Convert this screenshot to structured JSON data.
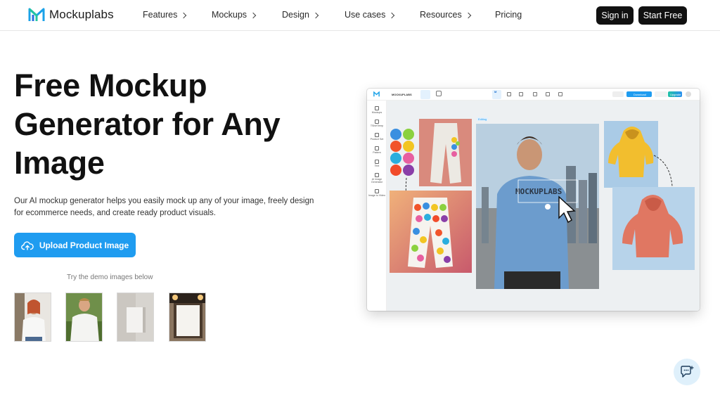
{
  "nav": {
    "logo_text": "Mockuplabs",
    "menu": [
      {
        "label": "Features",
        "has_chevron": true
      },
      {
        "label": "Mockups",
        "has_chevron": true
      },
      {
        "label": "Design",
        "has_chevron": true
      },
      {
        "label": "Use cases",
        "has_chevron": true
      },
      {
        "label": "Resources",
        "has_chevron": true
      },
      {
        "label": "Pricing",
        "has_chevron": false
      }
    ],
    "signin_label": "Sign in",
    "start_label": "Start Free"
  },
  "hero": {
    "title": "Free Mockup Generator for Any Image",
    "subtitle": "Our AI mockup generator helps you easily mock up any of your image, freely design for ecommerce needs, and create ready product visuals.",
    "upload_label": "Upload Product Image",
    "demo_label": "Try the demo images below",
    "demo_images": [
      "woman-white-tshirt",
      "man-white-hoodie",
      "blank-card",
      "framed-poster"
    ]
  },
  "app_preview": {
    "brand": "MOCKUPLABS",
    "toolbar": [
      "Mockup",
      "Edit",
      "Photoshop",
      "Magic",
      "Layers",
      "Canvas"
    ],
    "download_label": "Download",
    "upgrade_label": "Upgrade",
    "sidebar": [
      "Mockups",
      "TShirtTemp",
      "Product Set",
      "Pattern",
      "Text",
      "AI Image Generator",
      "Image to Video"
    ],
    "shirt_print": "MOCKUPLABS",
    "swatches": [
      "#3a8fe0",
      "#8bd13f",
      "#f1542a",
      "#f2c522",
      "#2aaede",
      "#e75fa0",
      "#f14b2a",
      "#8a3fa8"
    ]
  },
  "colors": {
    "accent": "#1f9cf0",
    "dark": "#111111"
  }
}
